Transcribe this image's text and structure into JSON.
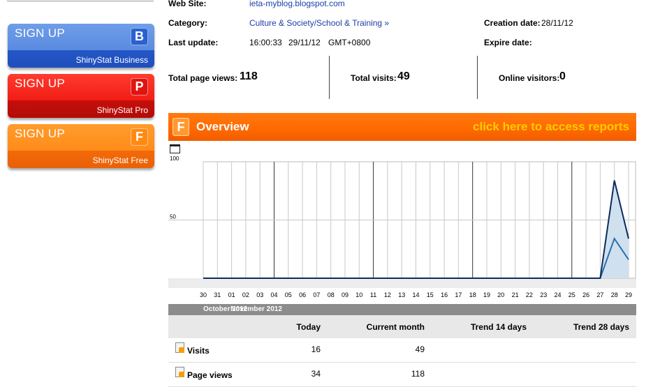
{
  "sidebar": {
    "signup_business": {
      "label": "SIGN UP",
      "badge": "B",
      "product": "ShinyStat Business"
    },
    "signup_pro": {
      "label": "SIGN UP",
      "badge": "P",
      "product": "ShinyStat Pro"
    },
    "signup_free": {
      "label": "SIGN UP",
      "badge": "F",
      "product": "ShinyStat Free"
    }
  },
  "info": {
    "website_label": "Web Site:",
    "website_value": "ieta-myblog.blogspot.com",
    "category_label": "Category:",
    "category_value": "Culture & Society/School & Training »",
    "creation_label": "Creation date:",
    "creation_value": "28/11/12",
    "update_label": "Last update:",
    "update_time": "16:00:33",
    "update_date": "29/11/12",
    "update_tz": "GMT+0800",
    "expire_label": "Expire date:"
  },
  "stats": {
    "page_views_label": "Total page views:",
    "page_views_value": "118",
    "visits_label": "Total visits:",
    "visits_value": "49",
    "online_label": "Online visitors:",
    "online_value": "0"
  },
  "overview": {
    "badge": "F",
    "title": "Overview",
    "cta": "click here to access reports"
  },
  "chart_data": {
    "type": "area",
    "x": [
      "30",
      "31",
      "01",
      "02",
      "03",
      "04",
      "05",
      "06",
      "07",
      "08",
      "09",
      "10",
      "11",
      "12",
      "13",
      "14",
      "15",
      "16",
      "17",
      "18",
      "19",
      "20",
      "21",
      "22",
      "23",
      "24",
      "25",
      "26",
      "27",
      "28",
      "29"
    ],
    "highlight_days": [
      "04",
      "11",
      "18",
      "25"
    ],
    "series": [
      {
        "values": [
          0,
          0,
          0,
          0,
          0,
          0,
          0,
          0,
          0,
          0,
          0,
          0,
          0,
          0,
          0,
          0,
          0,
          0,
          0,
          0,
          0,
          0,
          0,
          0,
          0,
          0,
          0,
          0,
          0,
          84,
          34
        ],
        "color": "#0d2b5c"
      },
      {
        "values": [
          0,
          0,
          0,
          0,
          0,
          0,
          0,
          0,
          0,
          0,
          0,
          0,
          0,
          0,
          0,
          0,
          0,
          0,
          0,
          0,
          0,
          0,
          0,
          0,
          0,
          0,
          0,
          0,
          0,
          34,
          16
        ],
        "color": "#2a6fb0"
      }
    ],
    "yticks": [
      "100",
      "50"
    ],
    "ylim": [
      0,
      100
    ]
  },
  "months": {
    "october": "October 2012",
    "november": "November 2012"
  },
  "table": {
    "headers": {
      "today": "Today",
      "month": "Current month",
      "trend14": "Trend 14 days",
      "trend28": "Trend 28 days"
    },
    "rows": [
      {
        "name": "Visits",
        "today": "16",
        "month": "49"
      },
      {
        "name": "Page views",
        "today": "34",
        "month": "118"
      }
    ]
  }
}
